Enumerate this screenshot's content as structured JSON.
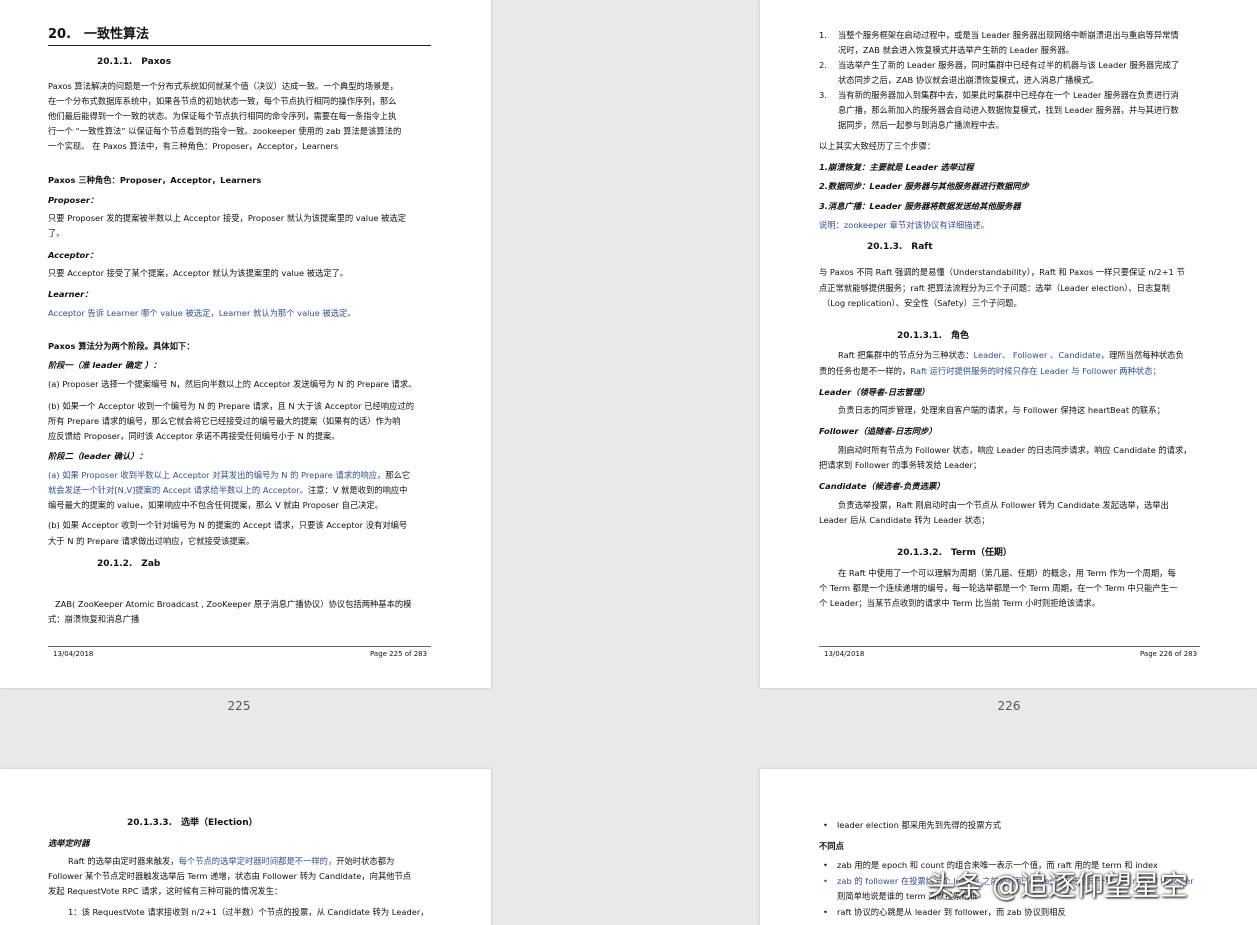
{
  "page_numbers": {
    "p225": "225",
    "p226": "226"
  },
  "p225": {
    "chapter": "20.　一致性算法",
    "s1": "20.1.1.　Paxos",
    "l1": "Paxos 算法解决的问题是一个分布式系统如何就某个值（决议）达成一致。一个典型的场景是，",
    "l2": "在一个分布式数据库系统中，如果各节点的初始状态一致，每个节点执行相同的操作序列，那么",
    "l3": "他们最后能得到一个一致的状态。为保证每个节点执行相同的命令序列，需要在每一条指令上执",
    "l4": "行一个 “一致性算法” 以保证每个节点看到的指令一致。zookeeper 使用的 zab 算法是该算法的",
    "l5": "一个实现。 在 Paxos 算法中，有三种角色：Proposer，Acceptor，Learners",
    "roles_h": "Paxos 三种角色：Proposer，Acceptor，Learners",
    "proposer_h": "Proposer：",
    "proposer_1": "只要 Proposer 发的提案被半数以上 Acceptor 接受，Proposer 就认为该提案里的 value 被选定",
    "proposer_2": "了。",
    "acceptor_h": "Acceptor：",
    "acceptor_1": "只要 Acceptor 接受了某个提案，Acceptor 就认为该提案里的 value 被选定了。",
    "learner_h": "Learner：",
    "learner_1": "Acceptor 告诉 Learner 哪个 value 被选定，Learner 就认为那个 value 被选定。",
    "phases_h": "Paxos 算法分为两个阶段。具体如下：",
    "phase1_h": "阶段一（准 leader 确定 ）：",
    "phase1_a": "(a) Proposer 选择一个提案编号 N，然后向半数以上的 Acceptor 发送编号为 N 的 Prepare 请求。",
    "phase1_b1": "(b) 如果一个 Acceptor 收到一个编号为 N 的 Prepare 请求，且 N 大于该 Acceptor 已经响应过的",
    "phase1_b2": "所有 Prepare 请求的编号，那么它就会将它已经接受过的编号最大的提案（如果有的话）作为响",
    "phase1_b3": "应反馈给 Proposer，同时该 Acceptor 承诺不再接受任何编号小于 N 的提案。",
    "phase2_h": "阶段二（leader 确认）：",
    "phase2_a1": "(a) 如果 Proposer 收到半数以上 Acceptor 对其发出的编号为 N 的 Prepare 请求的响应，",
    "phase2_a1b": "那么它",
    "phase2_a2": "就会发送一个针对[N,V]提案的 Accept 请求给半数以上的 Acceptor。",
    "phase2_a2b": "注意：V 就是收到的响应中",
    "phase2_a3": "编号最大的提案的 value，如果响应中不包含任何提案，那么 V 就由 Proposer 自己决定。",
    "phase2_b1": "(b) 如果 Acceptor 收到一个针对编号为 N 的提案的 Accept 请求，只要该 Acceptor 没有对编号",
    "phase2_b2": "大于 N 的 Prepare 请求做出过响应，它就接受该提案。",
    "s2": "20.1.2.　Zab",
    "zab1": "ZAB( ZooKeeper Atomic Broadcast , ZooKeeper 原子消息广播协议）协议包括两种基本的模",
    "zab2": "式：崩溃恢复和消息广播",
    "foot_date": "13/04/2018",
    "foot_page": "Page 225 of 283"
  },
  "p226": {
    "n1a": "当整个服务框架在启动过程中，或是当 Leader 服务器出现网络中断崩溃退出与重启等异常情",
    "n1b": "况时，ZAB 就会进入恢复模式并选举产生新的 Leader 服务器。",
    "n2a": "当选举产生了新的 Leader 服务器，同时集群中已经有过半的机器与该 Leader 服务器完成了",
    "n2b": "状态同步之后，ZAB 协议就会退出崩溃恢复模式，进入消息广播模式。",
    "n3a": "当有新的服务器加入到集群中去，如果此时集群中已经存在一个 Leader 服务器在负责进行消",
    "n3b": "息广播，那么新加入的服务器会自动进入数据恢复模式，找到 Leader 服务器，并与其进行数",
    "n3c": "据同步，然后一起参与到消息广播流程中去。",
    "summary": "以上其实大致经历了三个步骤：",
    "step1": "1.崩溃恢复：主要就是 Leader 选举过程",
    "step2": "2.数据同步：Leader 服务器与其他服务器进行数据同步",
    "step3": "3.消息广播：Leader 服务器将数据发送给其他服务器",
    "note": "说明：zookeeper 章节对该协议有详细描述。",
    "s3": "20.1.3.　Raft",
    "r1": "与 Paxos 不同 Raft 强调的是易懂（Understandability），Raft 和 Paxos 一样只要保证 n/2+1 节",
    "r2": "点正常就能够提供服务；raft 把算法流程分为三个子问题：选举（Leader election）、日志复制",
    "r3": "（Log replication）、安全性（Safety）三个子问题。",
    "s31": "20.1.3.1.　角色",
    "role1a": "Raft 把集群中的节点分为三种状态：",
    "role1b": "Leader、 Follower 、Candidate，",
    "role1c": "理所当然每种状态负",
    "role2a": "责的任务也是不一样的，",
    "role2b": "Raft 运行时提供服务的时候只存在 Leader 与 Follower 两种状态；",
    "leader_h": "Leader（领导者-日志管理）",
    "leader_1": "负责日志的同步管理，处理来自客户端的请求，与 Follower 保持这 heartBeat 的联系；",
    "follower_h": "Follower（追随者-日志同步）",
    "follower_1": "刚启动时所有节点为 Follower 状态，响应 Leader 的日志同步请求，响应 Candidate 的请求，",
    "follower_2": "把请求到 Follower 的事务转发给 Leader；",
    "candidate_h": "Candidate（候选者-负责选票）",
    "candidate_1": "负责选举投票，Raft 刚启动时由一个节点从 Follower 转为 Candidate 发起选举，选举出",
    "candidate_2": "Leader 后从 Candidate 转为 Leader 状态；",
    "s32": "20.1.3.2.　Term（任期）",
    "term1": "在 Raft 中使用了一个可以理解为周期（第几届、任期）的概念，用 Term 作为一个周期，每",
    "term2": "个 Term 都是一个连续递增的编号，每一轮选举都是一个 Term 周期，在一个 Term 中只能产生一",
    "term3": "个 Leader；当某节点收到的请求中 Term 比当前 Term 小时则拒绝该请求。",
    "foot_date": "13/04/2018",
    "foot_page": "Page 226 of 283"
  },
  "p227": {
    "s33": "20.1.3.3.　选举（Election）",
    "timer_h": "选举定时器",
    "e1a": "Raft 的选举由定时器来触发，",
    "e1b": "每个节点的选举定时器时间都是不一样的，",
    "e1c": "开始时状态都为",
    "e2": "Follower 某个节点定时器触发选举后 Term 递增，状态由 Follower 转为 Candidate，向其他节点",
    "e3": "发起 RequestVote RPC 请求，这时候有三种可能的情况发生：",
    "e4": "1：该 RequestVote 请求接收到 n/2+1（过半数）个节点的投票，从 Candidate 转为 Leader，"
  },
  "p228": {
    "b1": "leader election 都采用先到先得的投票方式",
    "diff_h": "不同点",
    "b2": "zab 用的是 epoch 和 count 的组合来唯一表示一个值，而 raft 用的是 term 和 index",
    "b3a": "zab 的 follower 在投票给一个 leader 之前必须和 leader 的日志达成一致，而 raft 的 follower",
    "b3b": "则简单地说是谁的 term 高就投票给谁",
    "b4": "raft 协议的心跳是从 leader 到 follower，而 zab 协议则相反"
  },
  "watermark": "头条 @追逐仰望星空"
}
